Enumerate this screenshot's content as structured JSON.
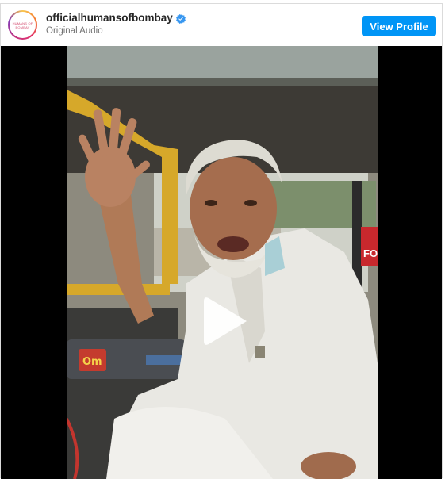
{
  "header": {
    "avatar_text": "HUMANS OF BOMBAY",
    "username": "officialhumansofbombay",
    "subtitle": "Original Audio",
    "view_profile_label": "View Profile"
  },
  "video": {
    "sign_text": "FO",
    "meter_text": "Om"
  },
  "icons": {
    "verified": "verified-badge-icon",
    "play": "play-icon"
  },
  "colors": {
    "accent": "#0095f6",
    "verified": "#3897f0"
  }
}
